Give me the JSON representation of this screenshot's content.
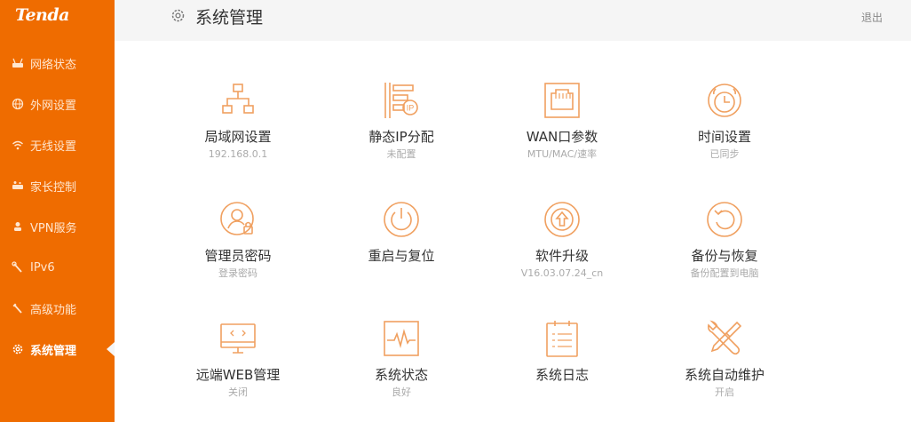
{
  "brand": {
    "logo_text": "Tenda",
    "accent": "#ef6c00",
    "icon_color": "#f0a060"
  },
  "header": {
    "title": "系统管理",
    "logout_label": "退出",
    "icon": "gear-icon"
  },
  "sidebar": {
    "items": [
      {
        "label": "网络状态",
        "icon": "router-icon",
        "active": false
      },
      {
        "label": "外网设置",
        "icon": "globe-icon",
        "active": false
      },
      {
        "label": "无线设置",
        "icon": "wifi-icon",
        "active": false
      },
      {
        "label": "家长控制",
        "icon": "parental-control-icon",
        "active": false
      },
      {
        "label": "VPN服务",
        "icon": "vpn-icon",
        "active": false
      },
      {
        "label": "IPv6",
        "icon": "wrench-icon",
        "active": false
      },
      {
        "label": "高级功能",
        "icon": "tools-icon",
        "active": false
      },
      {
        "label": "系统管理",
        "icon": "gear-icon",
        "active": true
      }
    ]
  },
  "tiles": [
    {
      "label": "局域网设置",
      "sub": "192.168.0.1",
      "icon": "lan-icon"
    },
    {
      "label": "静态IP分配",
      "sub": "未配置",
      "icon": "static-ip-icon"
    },
    {
      "label": "WAN口参数",
      "sub": "MTU/MAC/速率",
      "icon": "wan-port-icon"
    },
    {
      "label": "时间设置",
      "sub": "已同步",
      "icon": "alarm-clock-icon"
    },
    {
      "label": "管理员密码",
      "sub": "登录密码",
      "icon": "admin-password-icon"
    },
    {
      "label": "重启与复位",
      "sub": "",
      "icon": "power-icon"
    },
    {
      "label": "软件升级",
      "sub": "V16.03.07.24_cn",
      "icon": "upgrade-icon"
    },
    {
      "label": "备份与恢复",
      "sub": "备份配置到电脑",
      "icon": "restore-icon"
    },
    {
      "label": "远端WEB管理",
      "sub": "关闭",
      "icon": "remote-web-icon"
    },
    {
      "label": "系统状态",
      "sub": "良好",
      "icon": "system-status-icon"
    },
    {
      "label": "系统日志",
      "sub": "",
      "icon": "log-icon"
    },
    {
      "label": "系统自动维护",
      "sub": "开启",
      "icon": "maintenance-icon"
    }
  ]
}
